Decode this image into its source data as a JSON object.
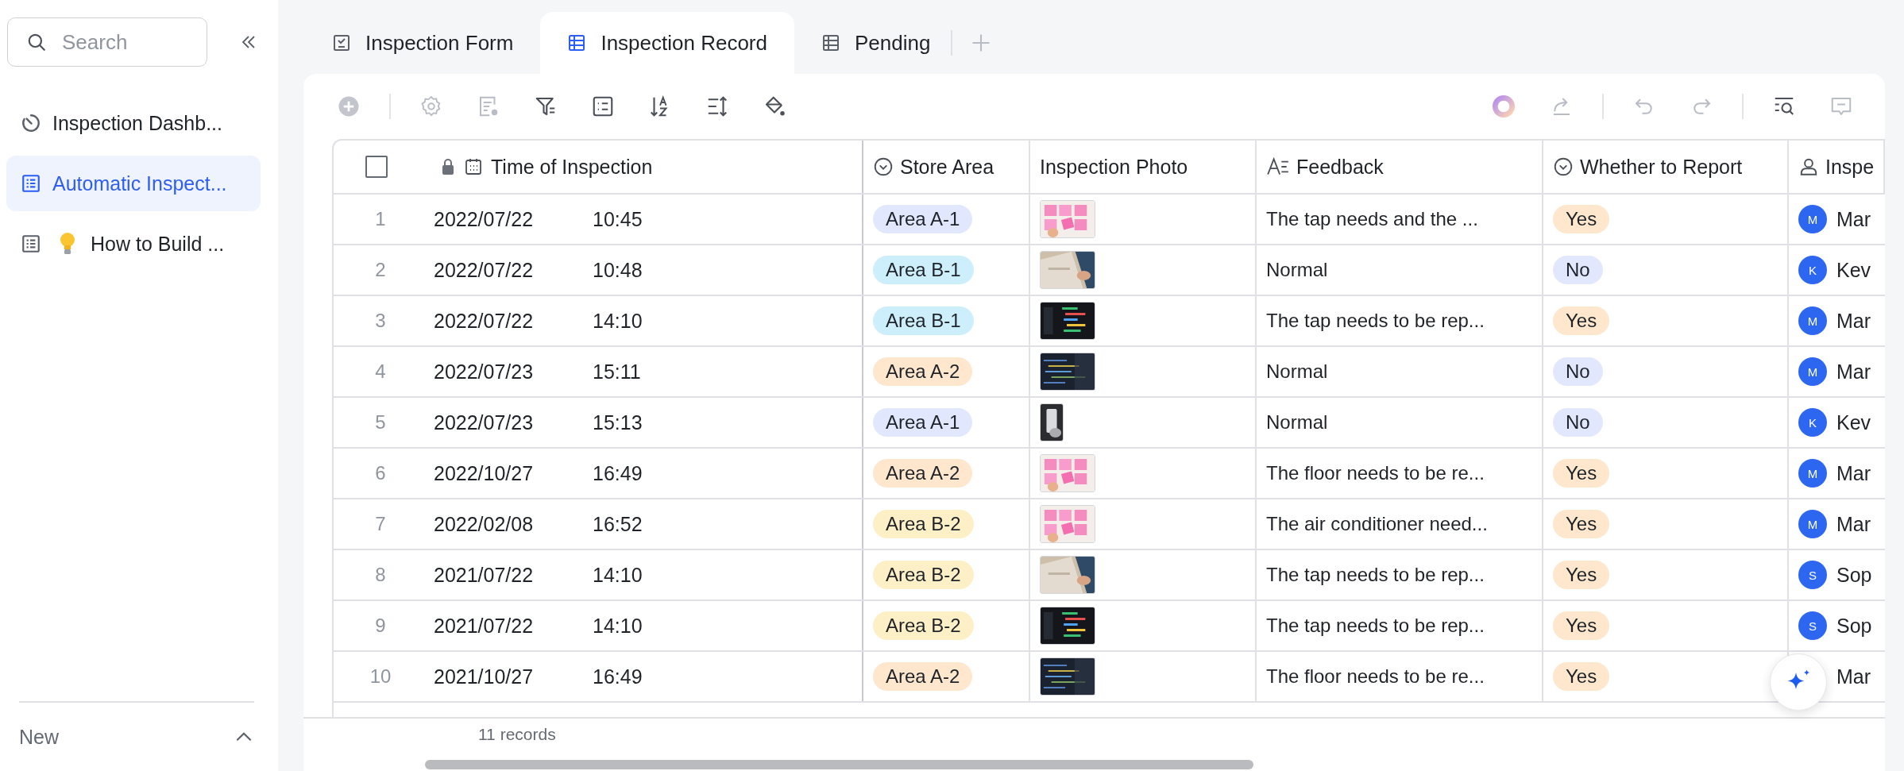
{
  "sidebar": {
    "search": {
      "placeholder": "Search"
    },
    "items": [
      {
        "label": "Inspection Dashb...",
        "kind": "dashboard",
        "bulb": false,
        "selected": false
      },
      {
        "label": "Automatic Inspect...",
        "kind": "sheet",
        "bulb": false,
        "selected": true
      },
      {
        "label": "How to Build ...",
        "kind": "sheet",
        "bulb": true,
        "selected": false
      }
    ],
    "footer": {
      "label": "New",
      "expanded": true
    }
  },
  "tabs": [
    {
      "label": "Inspection Form",
      "kind": "form",
      "selected": false
    },
    {
      "label": "Inspection Record",
      "kind": "grid",
      "selected": true
    },
    {
      "label": "Pending",
      "kind": "grid",
      "selected": false
    }
  ],
  "table": {
    "select_all": {
      "checked": false
    },
    "columns": [
      {
        "label": "Time of Inspection",
        "kind": "date",
        "locked": true
      },
      {
        "label": "Store Area",
        "kind": "select",
        "locked": false
      },
      {
        "label": "Inspection Photo",
        "locked": false
      },
      {
        "label": "Feedback",
        "kind": "text",
        "locked": false
      },
      {
        "label": "Whether to Report",
        "kind": "select",
        "locked": false
      },
      {
        "label": "Inspe",
        "kind": "person",
        "locked": false
      }
    ],
    "rows": [
      {
        "no": "1",
        "date": "2022/07/22",
        "time": "10:45",
        "area": {
          "label": "Area A-1",
          "color": "#e1e8fd"
        },
        "feedback": "The tap needs and the ...",
        "report": {
          "label": "Yes",
          "color": "#fee7cd"
        },
        "inspector": {
          "initial": "M",
          "name": "Mar"
        }
      },
      {
        "no": "2",
        "date": "2022/07/22",
        "time": "10:48",
        "area": {
          "label": "Area B-1",
          "color": "#cdeffb"
        },
        "feedback": "Normal",
        "report": {
          "label": "No",
          "color": "#e1e8fd"
        },
        "inspector": {
          "initial": "K",
          "name": "Kev"
        }
      },
      {
        "no": "3",
        "date": "2022/07/22",
        "time": "14:10",
        "area": {
          "label": "Area B-1",
          "color": "#cdeffb"
        },
        "feedback": "The tap needs to be rep...",
        "report": {
          "label": "Yes",
          "color": "#fee7cd"
        },
        "inspector": {
          "initial": "M",
          "name": "Mar"
        }
      },
      {
        "no": "4",
        "date": "2022/07/23",
        "time": "15:11",
        "area": {
          "label": "Area A-2",
          "color": "#fee7cd"
        },
        "feedback": "Normal",
        "report": {
          "label": "No",
          "color": "#e1e8fd"
        },
        "inspector": {
          "initial": "M",
          "name": "Mar"
        }
      },
      {
        "no": "5",
        "date": "2022/07/23",
        "time": "15:13",
        "area": {
          "label": "Area A-1",
          "color": "#e1e8fd"
        },
        "feedback": "Normal",
        "report": {
          "label": "No",
          "color": "#e1e8fd"
        },
        "inspector": {
          "initial": "K",
          "name": "Kev"
        }
      },
      {
        "no": "6",
        "date": "2022/10/27",
        "time": "16:49",
        "area": {
          "label": "Area A-2",
          "color": "#fee7cd"
        },
        "feedback": "The floor needs to be re...",
        "report": {
          "label": "Yes",
          "color": "#fee7cd"
        },
        "inspector": {
          "initial": "M",
          "name": "Mar"
        }
      },
      {
        "no": "7",
        "date": "2022/02/08",
        "time": "16:52",
        "area": {
          "label": "Area B-2",
          "color": "#fdf0c6"
        },
        "feedback": "The air conditioner need...",
        "report": {
          "label": "Yes",
          "color": "#fee7cd"
        },
        "inspector": {
          "initial": "M",
          "name": "Mar"
        }
      },
      {
        "no": "8",
        "date": "2021/07/22",
        "time": "14:10",
        "area": {
          "label": "Area B-2",
          "color": "#fdf0c6"
        },
        "feedback": "The tap needs to be rep...",
        "report": {
          "label": "Yes",
          "color": "#fee7cd"
        },
        "inspector": {
          "initial": "S",
          "name": "Sop"
        }
      },
      {
        "no": "9",
        "date": "2021/07/22",
        "time": "14:10",
        "area": {
          "label": "Area B-2",
          "color": "#fdf0c6"
        },
        "feedback": "The tap needs to be rep...",
        "report": {
          "label": "Yes",
          "color": "#fee7cd"
        },
        "inspector": {
          "initial": "S",
          "name": "Sop"
        }
      },
      {
        "no": "10",
        "date": "2021/10/27",
        "time": "16:49",
        "area": {
          "label": "Area A-2",
          "color": "#fee7cd"
        },
        "feedback": "The floor needs to be re...",
        "report": {
          "label": "Yes",
          "color": "#fee7cd"
        },
        "inspector": {
          "name": "Mar"
        }
      }
    ],
    "record_count": "11 records"
  }
}
